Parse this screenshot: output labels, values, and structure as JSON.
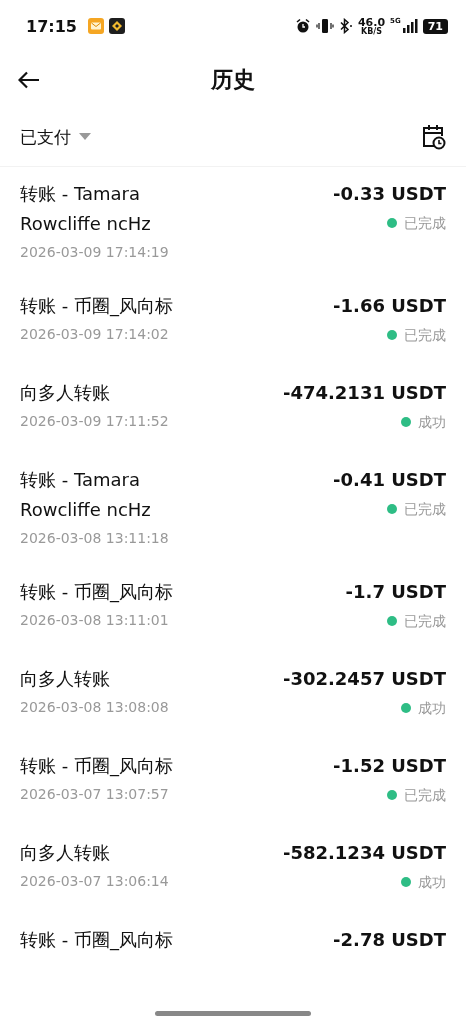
{
  "status_bar": {
    "time": "17:15",
    "speed": "46.0",
    "speed_unit": "KB/S",
    "network": "5G",
    "battery": "71"
  },
  "header": {
    "title": "历史"
  },
  "filter": {
    "label": "已支付"
  },
  "transactions": [
    {
      "title": "转账 - Tamara Rowcliffe ncHz",
      "date": "2026-03-09 17:14:19",
      "amount": "-0.33 USDT",
      "status": "已完成"
    },
    {
      "title": "转账 - 币圈_风向标",
      "date": "2026-03-09 17:14:02",
      "amount": "-1.66 USDT",
      "status": "已完成"
    },
    {
      "title": "向多人转账",
      "date": "2026-03-09 17:11:52",
      "amount": "-474.2131 USDT",
      "status": "成功"
    },
    {
      "title": "转账 - Tamara Rowcliffe ncHz",
      "date": "2026-03-08 13:11:18",
      "amount": "-0.41 USDT",
      "status": "已完成"
    },
    {
      "title": "转账 - 币圈_风向标",
      "date": "2026-03-08 13:11:01",
      "amount": "-1.7 USDT",
      "status": "已完成"
    },
    {
      "title": "向多人转账",
      "date": "2026-03-08 13:08:08",
      "amount": "-302.2457 USDT",
      "status": "成功"
    },
    {
      "title": "转账 - 币圈_风向标",
      "date": "2026-03-07 13:07:57",
      "amount": "-1.52 USDT",
      "status": "已完成"
    },
    {
      "title": "向多人转账",
      "date": "2026-03-07 13:06:14",
      "amount": "-582.1234 USDT",
      "status": "成功"
    },
    {
      "title": "转账 - 币圈_风向标",
      "amount": "-2.78 USDT"
    }
  ]
}
